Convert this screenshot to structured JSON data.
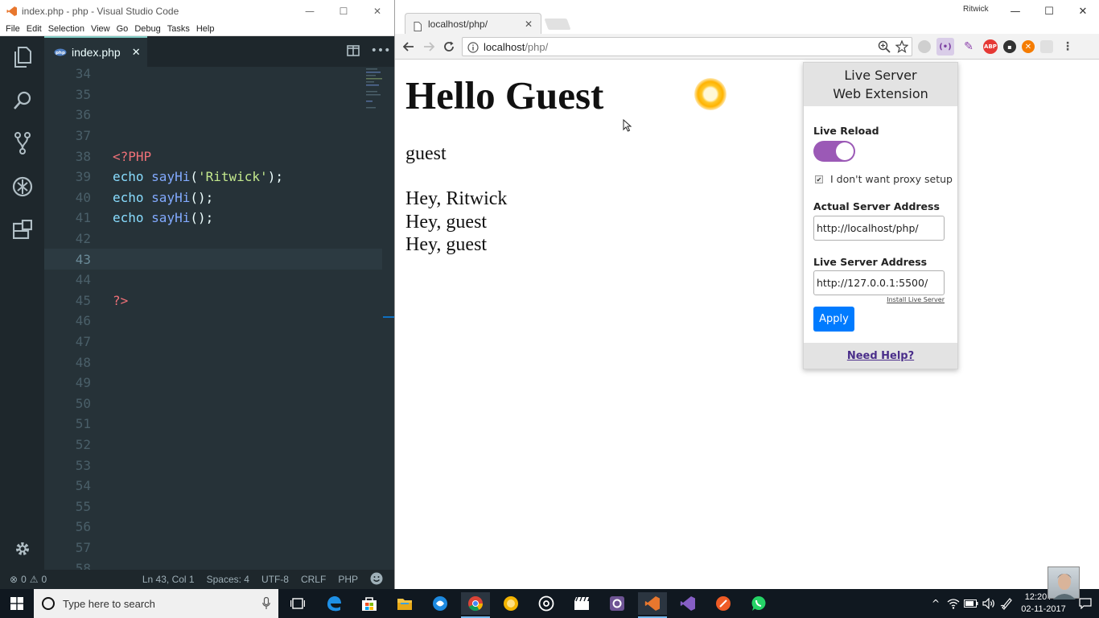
{
  "vscode": {
    "window_title": "index.php - php - Visual Studio Code",
    "menu": [
      "File",
      "Edit",
      "Selection",
      "View",
      "Go",
      "Debug",
      "Tasks",
      "Help"
    ],
    "tab": {
      "label": "index.php",
      "close": "✕"
    },
    "lines": [
      {
        "n": "34",
        "tokens": []
      },
      {
        "n": "35",
        "tokens": []
      },
      {
        "n": "36",
        "tokens": []
      },
      {
        "n": "37",
        "tokens": []
      },
      {
        "n": "38",
        "tokens": [
          {
            "t": "<?PHP",
            "c": "php-tag"
          }
        ]
      },
      {
        "n": "39",
        "tokens": [
          {
            "t": "echo ",
            "c": "kw"
          },
          {
            "t": "sayHi",
            "c": "fn"
          },
          {
            "t": "(",
            "c": "punc"
          },
          {
            "t": "'Ritwick'",
            "c": "str"
          },
          {
            "t": ");",
            "c": "punc"
          }
        ]
      },
      {
        "n": "40",
        "tokens": [
          {
            "t": "echo ",
            "c": "kw"
          },
          {
            "t": "sayHi",
            "c": "fn"
          },
          {
            "t": "();",
            "c": "punc"
          }
        ]
      },
      {
        "n": "41",
        "tokens": [
          {
            "t": "echo ",
            "c": "kw"
          },
          {
            "t": "sayHi",
            "c": "fn"
          },
          {
            "t": "();",
            "c": "punc"
          }
        ]
      },
      {
        "n": "42",
        "tokens": []
      },
      {
        "n": "43",
        "tokens": [],
        "current": true
      },
      {
        "n": "44",
        "tokens": []
      },
      {
        "n": "45",
        "tokens": [
          {
            "t": "?>",
            "c": "php-tag"
          }
        ]
      },
      {
        "n": "46",
        "tokens": []
      },
      {
        "n": "47",
        "tokens": []
      },
      {
        "n": "48",
        "tokens": []
      },
      {
        "n": "49",
        "tokens": []
      },
      {
        "n": "50",
        "tokens": []
      },
      {
        "n": "51",
        "tokens": []
      },
      {
        "n": "52",
        "tokens": []
      },
      {
        "n": "53",
        "tokens": []
      },
      {
        "n": "54",
        "tokens": []
      },
      {
        "n": "55",
        "tokens": []
      },
      {
        "n": "56",
        "tokens": []
      },
      {
        "n": "57",
        "tokens": []
      },
      {
        "n": "58",
        "tokens": []
      }
    ],
    "status": {
      "errors": "0",
      "warnings": "0",
      "position": "Ln 43, Col 1",
      "spaces": "Spaces: 4",
      "encoding": "UTF-8",
      "eol": "CRLF",
      "language": "PHP"
    }
  },
  "chrome": {
    "tab_label": "localhost/php/",
    "tab_close": "✕",
    "profile": "Ritwick",
    "url_host": "localhost",
    "url_path": "/php/",
    "page": {
      "heading": "Hello Guest",
      "guest": "guest",
      "lines": [
        "Hey, Ritwick",
        "Hey, guest",
        "Hey, guest"
      ]
    }
  },
  "live_server": {
    "header_line1": "Live Server",
    "header_line2": "Web Extension",
    "live_reload_label": "Live Reload",
    "live_reload_on": true,
    "proxy_label": "I don't want proxy setup",
    "proxy_checked": true,
    "actual_label": "Actual Server Address",
    "actual_value": "http://localhost/php/",
    "live_label": "Live Server Address",
    "live_value": "http://127.0.0.1:5500/",
    "install_link": "Install Live Server",
    "apply": "Apply",
    "help": "Need Help?"
  },
  "taskbar": {
    "search_placeholder": "Type here to search",
    "time": "12:20 AM",
    "date": "02-11-2017"
  },
  "colors": {
    "vscode_bg": "#263238",
    "toggle": "#9b59b6",
    "apply_button": "#007bff",
    "help_link": "#4a2e8a"
  }
}
